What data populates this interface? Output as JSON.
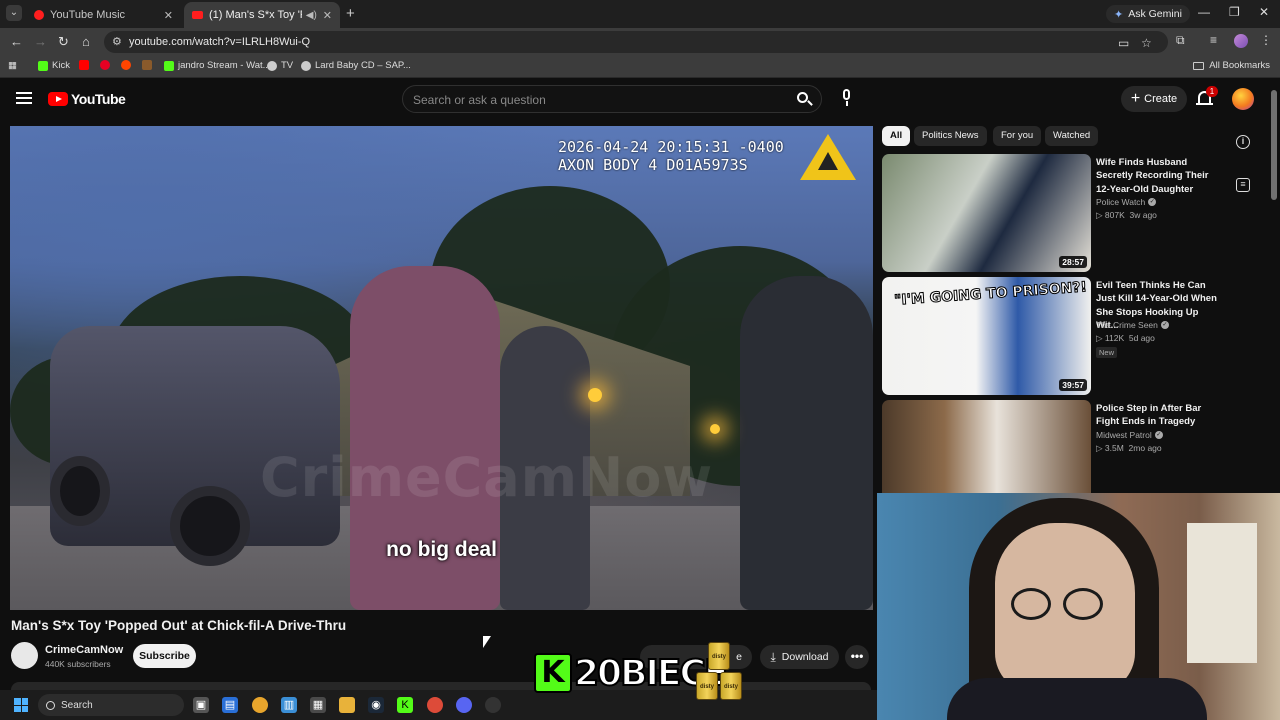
{
  "browser": {
    "tabs": [
      {
        "title": "YouTube Music",
        "active": false
      },
      {
        "title": "(1) Man's S*x Toy 'Popped O",
        "active": true
      }
    ],
    "ask_gemini": "Ask Gemini",
    "url": "youtube.com/watch?v=ILRLH8Wui-Q",
    "bookmarks": [
      {
        "label": "Kick",
        "icon": "kick-icon",
        "color": "#53fc18"
      },
      {
        "label": "",
        "icon": "youtube-icon",
        "color": "#ff0000"
      },
      {
        "label": "",
        "icon": "pinterest-icon",
        "color": "#e60023"
      },
      {
        "label": "",
        "icon": "reddit-icon",
        "color": "#ff4500"
      },
      {
        "label": "",
        "icon": "minecraft-icon",
        "color": "#8a5a2b"
      },
      {
        "label": "jandro Stream - Wat...",
        "icon": "kick-icon",
        "color": "#53fc18"
      },
      {
        "label": "TV",
        "icon": "globe-icon",
        "color": "#cccccc"
      },
      {
        "label": "Lard Baby CD – SAP...",
        "icon": "globe-icon",
        "color": "#cccccc"
      }
    ],
    "all_bookmarks": "All Bookmarks"
  },
  "youtube": {
    "logo_text": "YouTube",
    "search_placeholder": "Search or ask a question",
    "create_label": "Create",
    "notification_count": "1"
  },
  "player": {
    "timestamp_line1": "2026-04-24 20:15:31 -0400",
    "timestamp_line2": "AXON BODY 4 D01A5973S",
    "watermark": "CrimeCamNow",
    "caption": "no big deal"
  },
  "video": {
    "title": "Man's S*x Toy 'Popped Out' at Chick-fil-A Drive-Thru",
    "channel": "CrimeCamNow",
    "subscribers": "440K subscribers",
    "subscribe_label": "Subscribe",
    "download_label": "Download",
    "share_label_fragment": "e",
    "more_label": "•••"
  },
  "chips": [
    "All",
    "Politics News",
    "For you",
    "Watched"
  ],
  "recommendations": [
    {
      "title": "Wife Finds Husband Secretly Recording Their 12-Year-Old Daughter",
      "channel": "Police Watch",
      "views": "807K",
      "age": "3w ago",
      "duration": "28:57",
      "badge": ""
    },
    {
      "title": "Evil Teen Thinks He Can Just Kill 14-Year-Old When She Stops Hooking Up Wit...",
      "channel": "The Crime Seen",
      "views": "112K",
      "age": "5d ago",
      "duration": "39:57",
      "badge": "New",
      "thumb_text": "\"I'M GOING TO PRISON?!"
    },
    {
      "title": "Police Step in After Bar Fight Ends in Tragedy",
      "channel": "Midwest Patrol",
      "views": "3.5M",
      "age": "2mo ago",
      "duration": "",
      "badge": ""
    }
  ],
  "overlay": {
    "kick_letter": "K",
    "streamer_name": "20BIECE",
    "can_label": "disty"
  },
  "taskbar": {
    "search_label": "Search"
  },
  "colors": {
    "youtube_red": "#ff0000",
    "kick_green": "#53fc18",
    "background": "#0f0f0f"
  }
}
